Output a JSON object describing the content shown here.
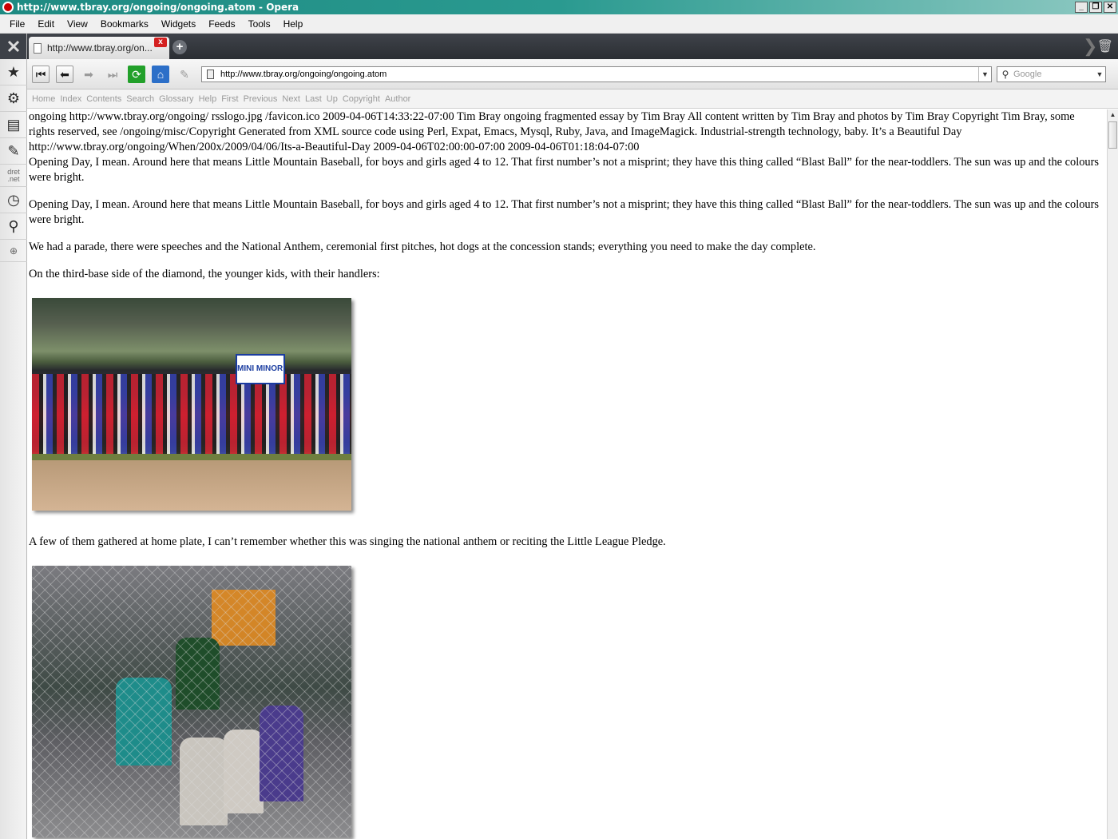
{
  "window": {
    "title": "http://www.tbray.org/ongoing/ongoing.atom - Opera",
    "buttons": [
      "_",
      "❐",
      "✕"
    ]
  },
  "menu": [
    "File",
    "Edit",
    "View",
    "Bookmarks",
    "Widgets",
    "Feeds",
    "Tools",
    "Help"
  ],
  "panel": {
    "items": [
      "panel-toggle-icon",
      "bookmarks-star-icon",
      "widgets-gear-icon",
      "notes-icon",
      "transfers-icon",
      "dret-net-icon",
      "history-clock-icon",
      "links-icon",
      "add-panel-icon"
    ],
    "dret_label": "dret .net"
  },
  "tab": {
    "label": "http://www.tbray.org/on...",
    "close": "x",
    "new_tab": "+"
  },
  "address": {
    "url": "http://www.tbray.org/ongoing/ongoing.atom",
    "dropdown": "▼"
  },
  "search": {
    "placeholder": "Google",
    "dropdown": "▼"
  },
  "nav_links": [
    "Home",
    "Index",
    "Contents",
    "Search",
    "Glossary",
    "Help",
    "First",
    "Previous",
    "Next",
    "Last",
    "Up",
    "Copyright",
    "Author"
  ],
  "content": {
    "feed_header": "ongoing http://www.tbray.org/ongoing/ rsslogo.jpg /favicon.ico 2009-04-06T14:33:22-07:00 Tim Bray ongoing fragmented essay by Tim Bray All content written by Tim Bray and photos by Tim Bray Copyright Tim Bray, some rights reserved, see /ongoing/misc/Copyright Generated from XML source code using Perl, Expat, Emacs, Mysql, Ruby, Java, and ImageMagick. Industrial-strength technology, baby. It’s a Beautiful Day http://www.tbray.org/ongoing/When/200x/2009/04/06/Its-a-Beautiful-Day 2009-04-06T02:00:00-07:00 2009-04-06T01:18:04-07:00",
    "summary": "Opening Day, I mean. Around here that means Little Mountain Baseball, for boys and girls aged 4 to 12. That first number’s not a misprint; they have this thing called “Blast Ball” for the near-toddlers. The sun was up and the colours were bright.",
    "p1": "Opening Day, I mean. Around here that means Little Mountain Baseball, for boys and girls aged 4 to 12. That first number’s not a misprint; they have this thing called “Blast Ball” for the near-toddlers. The sun was up and the colours were bright.",
    "p2": "We had a parade, there were speeches and the National Anthem, ceremonial first pitches, hot dogs at the concession stands; everything you need to make the day complete.",
    "p3": "On the third-base side of the diamond, the younger kids, with their handlers:",
    "photo1_sign": "MINI MINOR A",
    "p4": "A few of them gathered at home plate, I can’t remember whether this was singing the national anthem or reciting the Little League Pledge."
  }
}
